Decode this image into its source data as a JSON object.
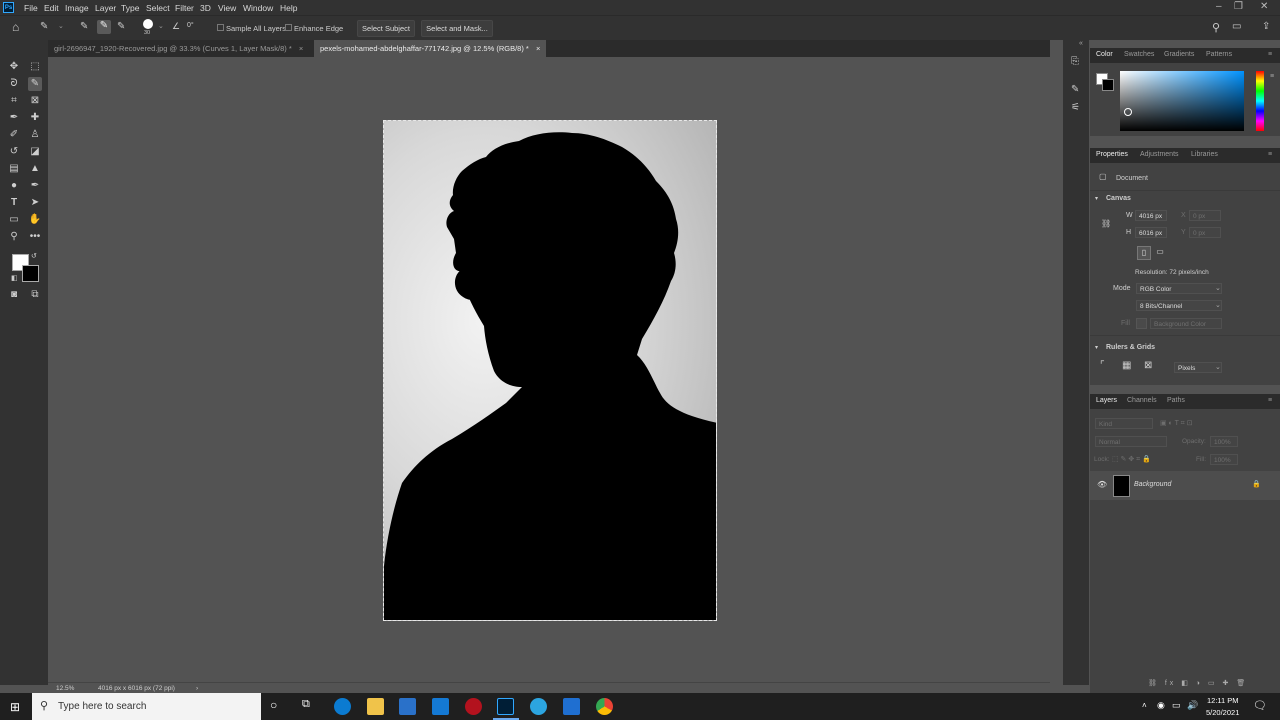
{
  "app": {
    "logo": "Ps"
  },
  "menu": [
    "File",
    "Edit",
    "Image",
    "Layer",
    "Type",
    "Select",
    "Filter",
    "3D",
    "View",
    "Window",
    "Help"
  ],
  "options": {
    "brush_size": "30",
    "angle": "0°",
    "sample_all_layers": "Sample All Layers",
    "enhance_edge": "Enhance Edge",
    "select_subject": "Select Subject",
    "select_and_mask": "Select and Mask..."
  },
  "tabs": [
    {
      "label": "girl-2696947_1920-Recovered.jpg @ 33.3% (Curves 1, Layer Mask/8) *",
      "close": "×"
    },
    {
      "label": "pexels-mohamed-abdelghaffar-771742.jpg @ 12.5% (RGB/8) *",
      "close": "×"
    }
  ],
  "status": {
    "zoom": "12.5%",
    "doc_info": "4016 px x 6016 px (72 ppi)",
    "arrow": "›"
  },
  "color_panel": {
    "tabs": [
      "Color",
      "Swatches",
      "Gradients",
      "Patterns"
    ],
    "fg_color": "#ffffff",
    "bg_color": "#000000"
  },
  "properties": {
    "tabs": [
      "Properties",
      "Adjustments",
      "Libraries"
    ],
    "doc_label": "Document",
    "canvas_section": "Canvas",
    "w_label": "W",
    "w_value": "4016 px",
    "h_label": "H",
    "h_value": "6016 px",
    "x_label": "X",
    "x_value": "0 px",
    "y_label": "Y",
    "y_value": "0 px",
    "resolution": "Resolution: 72 pixels/inch",
    "mode_label": "Mode",
    "mode_value": "RGB Color",
    "depth_value": "8 Bits/Channel",
    "fill_label": "Fill",
    "fill_value": "Background Color",
    "rulers_section": "Rulers & Grids",
    "units_value": "Pixels"
  },
  "layers": {
    "tabs": [
      "Layers",
      "Channels",
      "Paths"
    ],
    "kind_placeholder": "Kind",
    "blend_mode": "Normal",
    "opacity_label": "Opacity:",
    "opacity_value": "100%",
    "lock_label": "Lock:",
    "fill_label": "Fill:",
    "fill_value": "100%",
    "items": [
      {
        "name": "Background",
        "visible": true,
        "locked": true
      }
    ]
  },
  "taskbar": {
    "search_placeholder": "Type here to search",
    "time": "12:11 PM",
    "date": "5/20/2021"
  }
}
